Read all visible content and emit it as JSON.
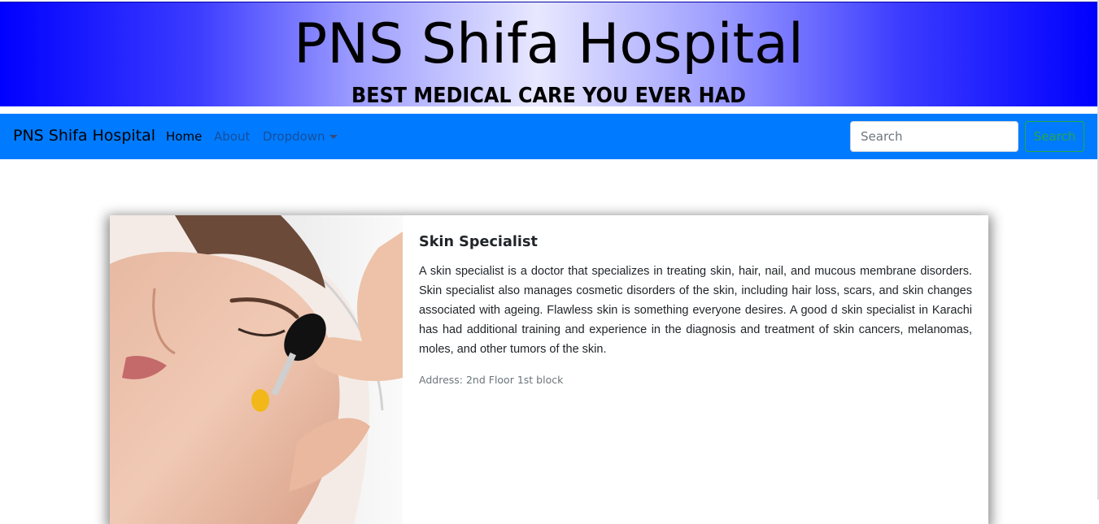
{
  "banner": {
    "title": "PNS Shifa Hospital",
    "subtitle": "BEST MEDICAL CARE YOU EVER HAD"
  },
  "navbar": {
    "brand": "PNS Shifa Hospital",
    "links": {
      "home": "Home",
      "about": "About",
      "dropdown": "Dropdown"
    },
    "search": {
      "placeholder": "Search",
      "button_label": "Search"
    }
  },
  "card": {
    "title": "Skin Specialist",
    "text": "A skin specialist is a doctor that specializes in treating skin, hair, nail, and mucous membrane disorders. Skin specialist also manages cosmetic disorders of the skin, including hair loss, scars, and skin changes associated with ageing. Flawless skin is something everyone desires. A good d skin specialist in Karachi has had additional training and experience in the diagnosis and treatment of skin cancers, melanomas, moles, and other tumors of the skin.",
    "address": "Address: 2nd Floor 1st block"
  },
  "colors": {
    "navbar_bg": "#007bff",
    "banner_edge": "#0000ff",
    "search_button": "#28a745"
  },
  "icons": {
    "dropdown_caret": "caret-down-icon"
  }
}
